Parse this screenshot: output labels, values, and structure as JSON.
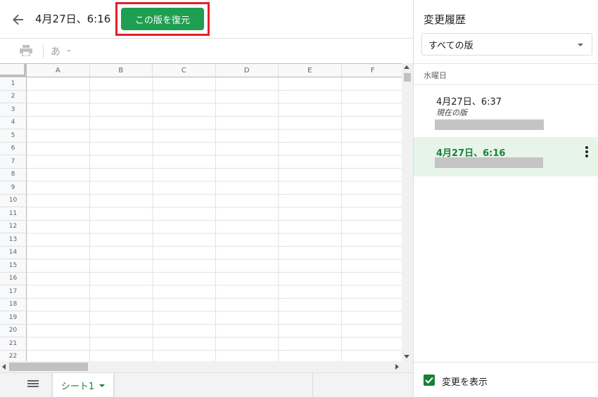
{
  "header": {
    "title": "4月27日、6:16",
    "restore_label": "この版を復元"
  },
  "toolbar": {
    "ime_label": "あ"
  },
  "grid": {
    "columns": [
      "A",
      "B",
      "C",
      "D",
      "E",
      "F"
    ],
    "rows": [
      "1",
      "2",
      "3",
      "4",
      "5",
      "6",
      "7",
      "8",
      "9",
      "10",
      "11",
      "12",
      "13",
      "14",
      "15",
      "16",
      "17",
      "18",
      "19",
      "20",
      "21",
      "22"
    ]
  },
  "sheet_tabs": {
    "active_tab": "シート1"
  },
  "history_panel": {
    "title": "変更履歴",
    "filter_value": "すべての版",
    "day_label": "水曜日",
    "versions": [
      {
        "time": "4月27日、6:37",
        "subtitle": "現在の版"
      },
      {
        "time": "4月27日、6:16"
      }
    ],
    "show_changes_label": "変更を表示"
  },
  "colors": {
    "accent_green": "#188038",
    "restore_button": "#1e9e50",
    "highlight_frame": "#e3202a",
    "selected_version_bg": "#e6f4ea"
  }
}
